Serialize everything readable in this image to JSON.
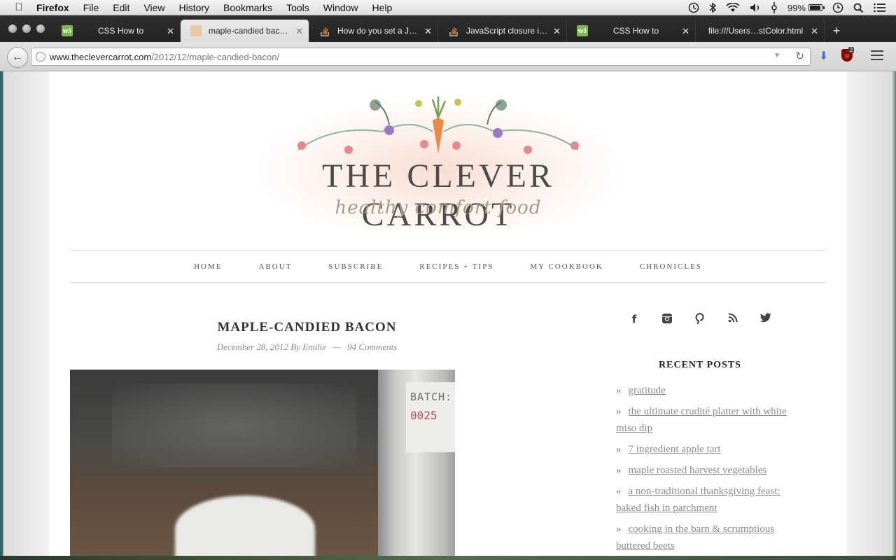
{
  "menubar": {
    "app_name": "Firefox",
    "items": [
      "File",
      "Edit",
      "View",
      "History",
      "Bookmarks",
      "Tools",
      "Window",
      "Help"
    ],
    "battery_percent": "99%",
    "battery_level": 0.99,
    "status_icons": [
      "time-machine-icon",
      "bluetooth-icon",
      "wifi-icon",
      "volume-icon",
      "input-icon",
      "battery-icon",
      "clock-icon",
      "spotlight-icon",
      "notification-list-icon"
    ]
  },
  "tabs": [
    {
      "label": "CSS How to",
      "favicon": "w3",
      "active": false
    },
    {
      "label": "maple-candied baco…",
      "favicon": "carrot",
      "active": true
    },
    {
      "label": "How do you set a Jav…",
      "favicon": "stackoverflow",
      "active": false
    },
    {
      "label": "JavaScript closure ins…",
      "favicon": "stackoverflow",
      "active": false
    },
    {
      "label": "CSS How to",
      "favicon": "w3",
      "active": false
    },
    {
      "label": "file:///Users…stColor.html",
      "favicon": "none",
      "active": false
    }
  ],
  "urlbar": {
    "host": "www.theclevercarrot.com",
    "path": "/2012/12/maple-candied-bacon/"
  },
  "toolbar": {
    "ublock_badge": "2"
  },
  "site": {
    "logo_title": "THE CLEVER CARROT",
    "logo_tagline": "healthy comfort food",
    "nav": [
      "HOME",
      "ABOUT",
      "SUBSCRIBE",
      "RECIPES + TIPS",
      "MY COOKBOOK",
      "CHRONICLES"
    ]
  },
  "post": {
    "title": "MAPLE-CANDIED BACON",
    "date": "December 28, 2012",
    "author_prefix": "By",
    "author": "Emilie",
    "separator": "—",
    "comments": "94 Comments",
    "image_label_line1": "BATCH:",
    "image_label_line2": "0025"
  },
  "sidebar": {
    "social": [
      {
        "icon": "facebook-icon",
        "glyph": "f"
      },
      {
        "icon": "instagram-icon",
        "glyph": "◙"
      },
      {
        "icon": "pinterest-icon",
        "glyph": "P"
      },
      {
        "icon": "rss-icon",
        "glyph": "◟"
      },
      {
        "icon": "twitter-icon",
        "glyph": "🐦"
      }
    ],
    "recent_posts_title": "RECENT POSTS",
    "recent_posts": [
      "gratitude",
      "the ultimate crudité platter with white miso dip",
      "7 ingredient apple tart",
      "maple roasted harvest vegetables",
      "a non-traditional thanksgiving feast: baked fish in parchment",
      "cooking in the barn & scrumptious buttered beets"
    ],
    "bullet": "»"
  },
  "colors": {
    "w3_green": "#7db94a",
    "link_gray": "#8c8c8c",
    "carrot_orange": "#e98a45"
  }
}
